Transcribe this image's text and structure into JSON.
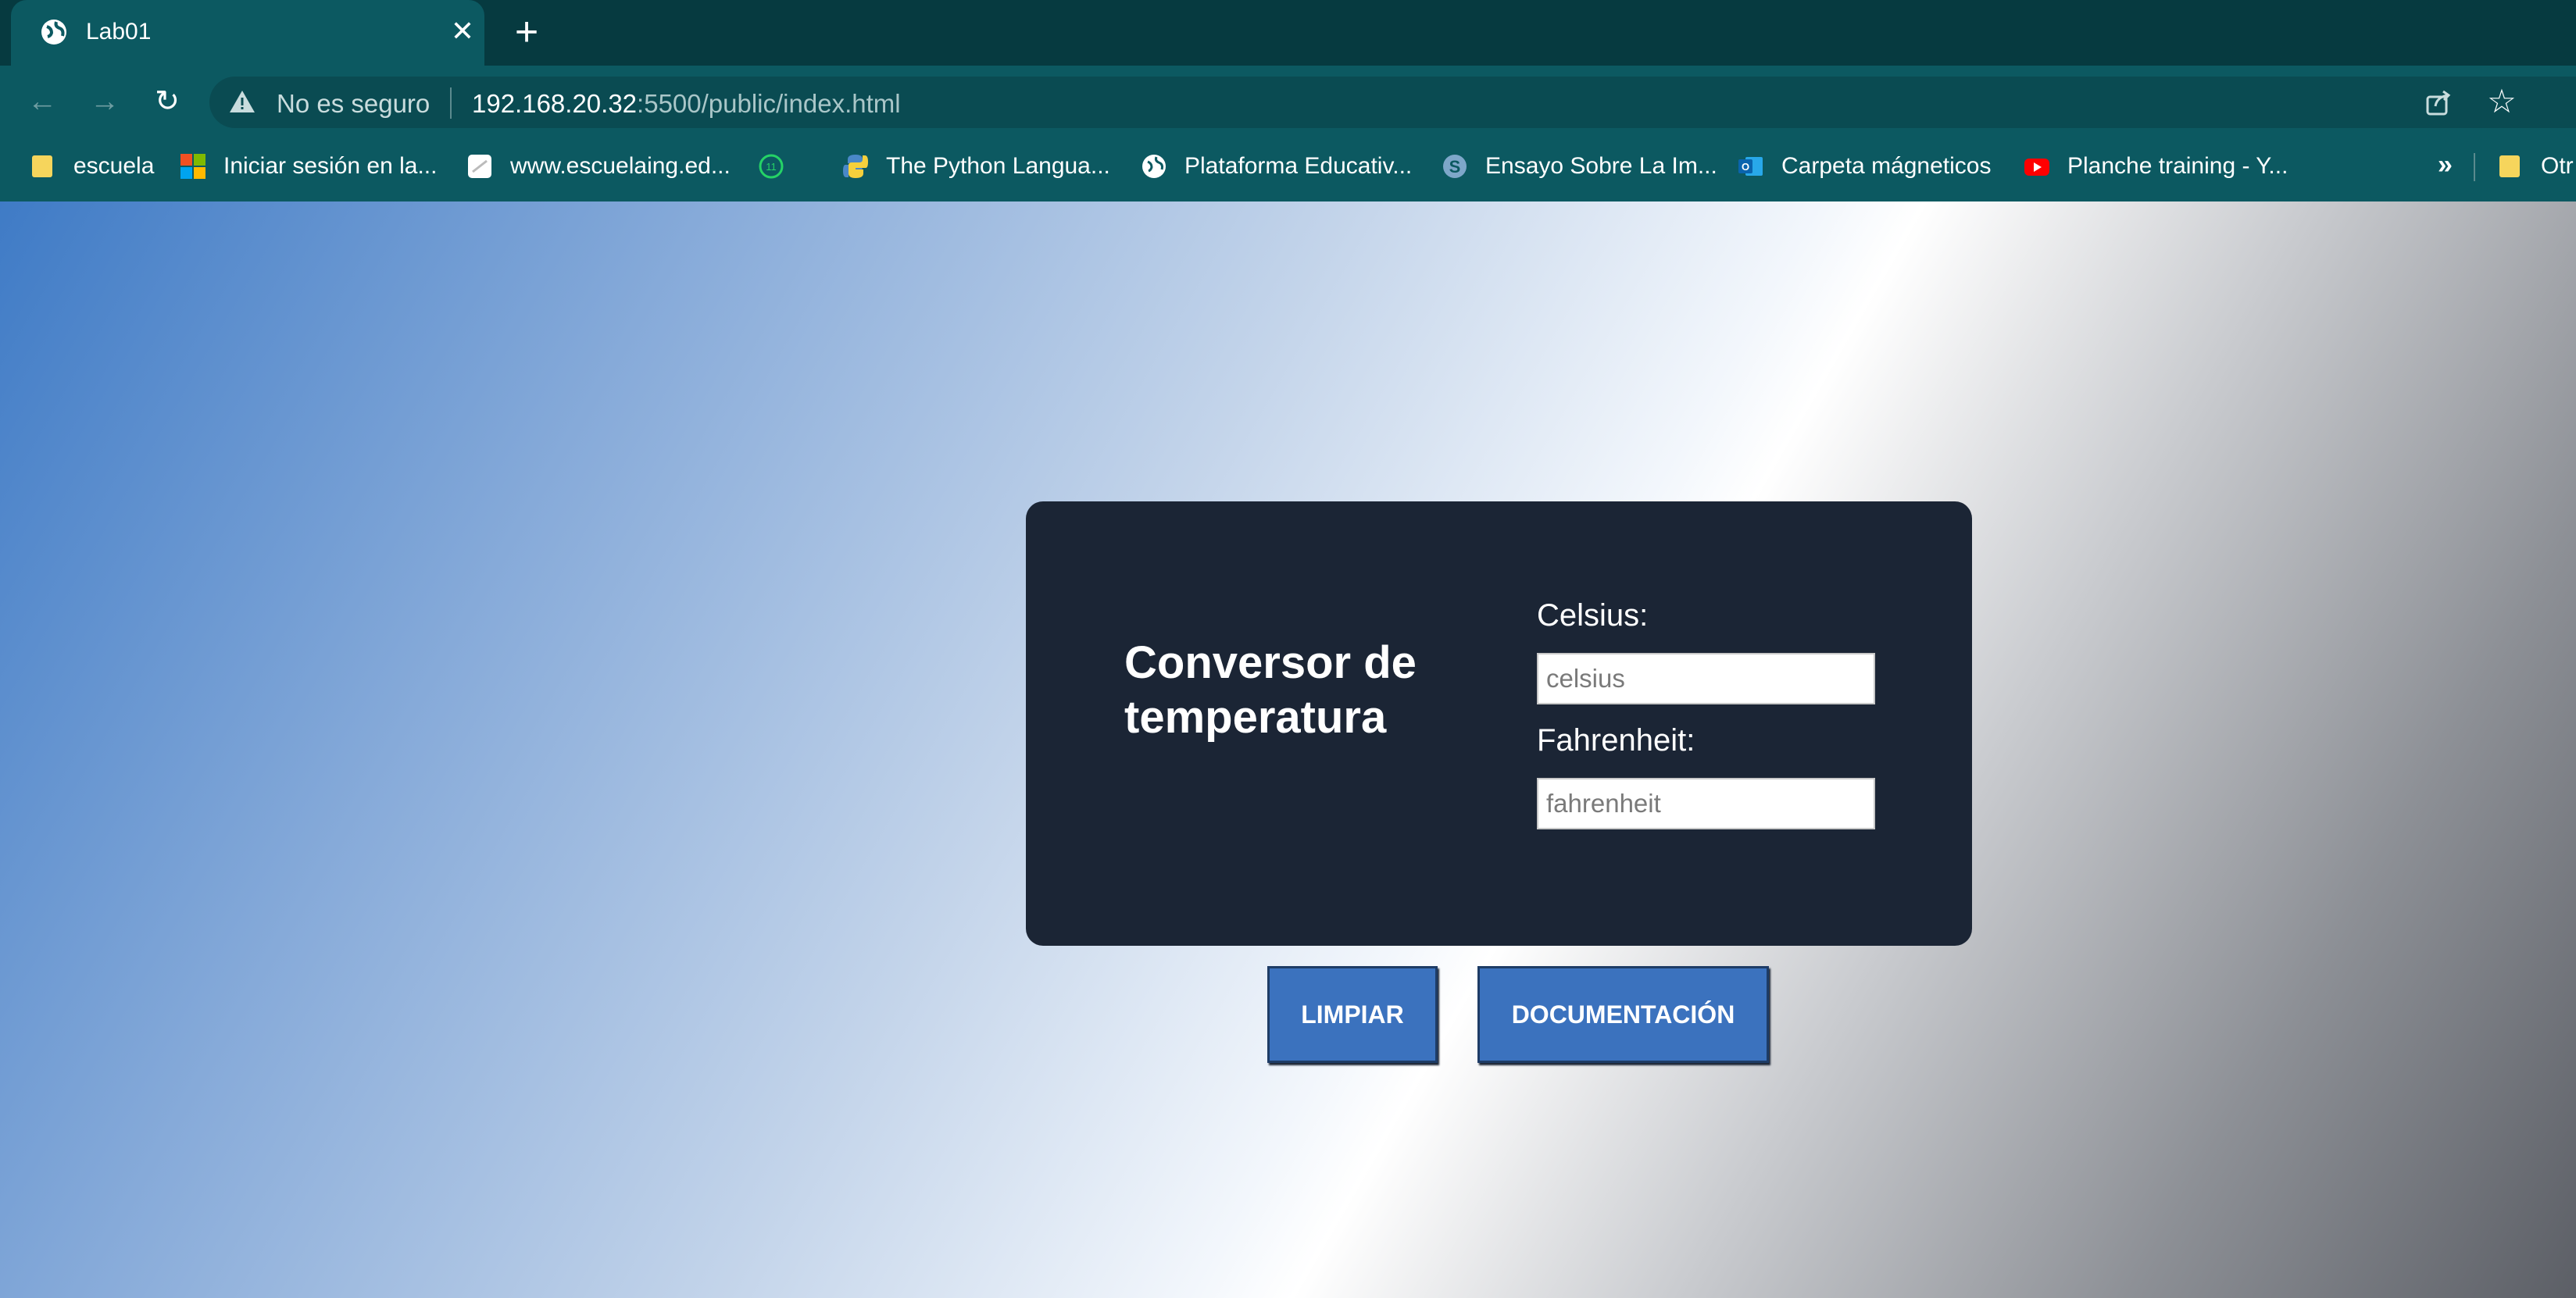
{
  "browser": {
    "tab": {
      "title": "Lab01"
    },
    "omnibox": {
      "security_label": "No es seguro",
      "url_host": "192.168.20.32",
      "url_path": ":5500/public/index.html"
    },
    "bookmarks": [
      {
        "label": "escuela",
        "icon": "folder-icon"
      },
      {
        "label": "Iniciar sesión en la...",
        "icon": "microsoft-icon"
      },
      {
        "label": "www.escuelaing.ed...",
        "icon": "page-icon"
      },
      {
        "label": "",
        "icon": "whatsapp-icon",
        "badge": "11"
      },
      {
        "label": "The Python Langua...",
        "icon": "python-icon"
      },
      {
        "label": "Plataforma Educativ...",
        "icon": "globe-icon"
      },
      {
        "label": "Ensayo Sobre La Im...",
        "icon": "s-logo-icon"
      },
      {
        "label": "Carpeta mágneticos",
        "icon": "outlook-icon"
      },
      {
        "label": "Planche training - Y...",
        "icon": "youtube-icon"
      },
      {
        "label": "Otr",
        "icon": "folder-icon"
      }
    ],
    "more_bookmarks": "»"
  },
  "page": {
    "card": {
      "title": "Conversor de temperatura",
      "celsius_label": "Celsius:",
      "celsius_placeholder": "celsius",
      "fahrenheit_label": "Fahrenheit:",
      "fahrenheit_placeholder": "fahrenheit"
    },
    "buttons": {
      "clear": "LIMPIAR",
      "docs": "DOCUMENTACIÓN"
    }
  },
  "colors": {
    "card_bg": "#1b2535",
    "button_bg": "#3b72be",
    "chrome_bg": "#0c5961"
  }
}
